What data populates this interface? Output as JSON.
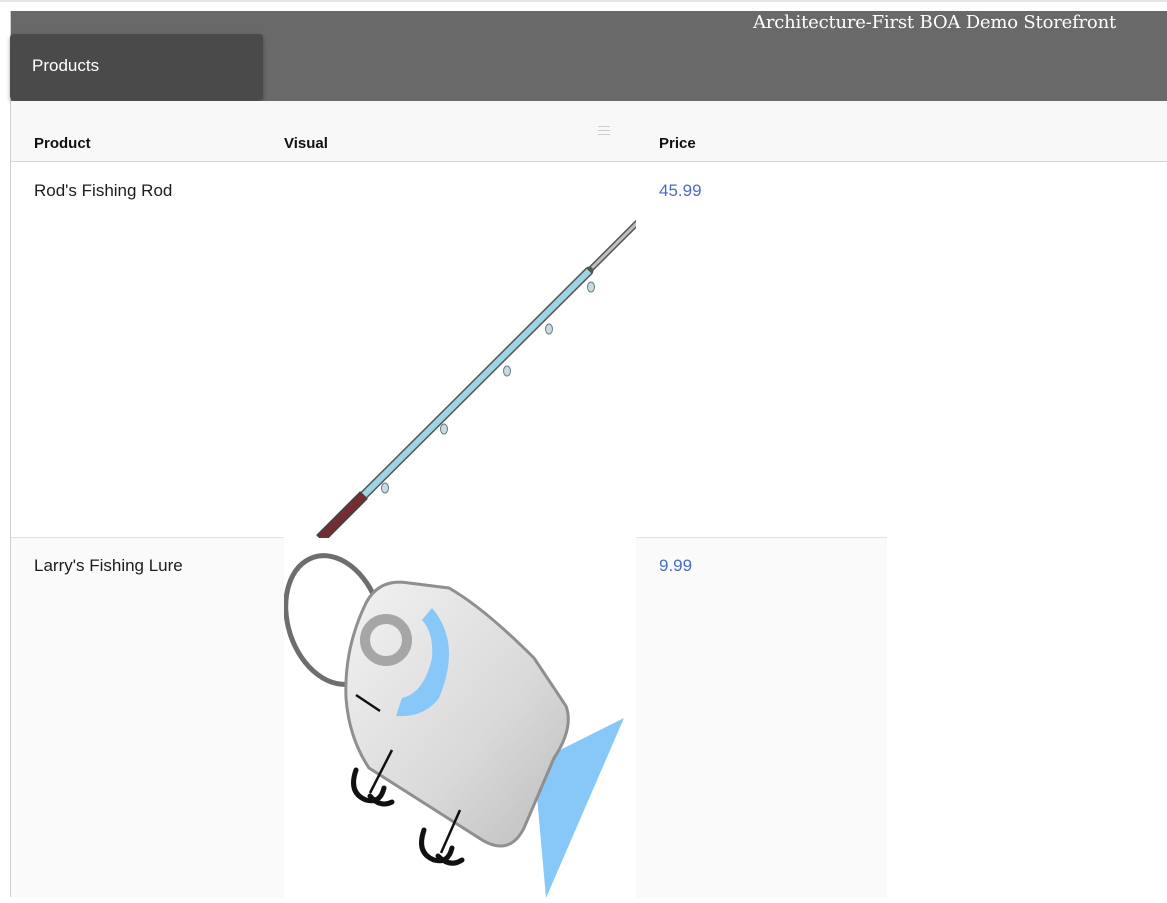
{
  "header": {
    "title": "Architecture-First BOA Demo Storefront",
    "tab_label": "Products"
  },
  "grid": {
    "columns": [
      "Product",
      "Visual",
      "Price"
    ],
    "rows": [
      {
        "product": "Rod's Fishing Rod",
        "visual": "fishing-rod-image",
        "price": "45.99"
      },
      {
        "product": "Larry's Fishing Lure",
        "visual": "fishing-lure-image",
        "price": "9.99"
      }
    ]
  },
  "colors": {
    "header_bg": "#696969",
    "tab_bg": "#4a4a4a",
    "price_link": "#4a6cc4",
    "rod_blank": "#9fd4e3",
    "rod_handle": "#9b1b25",
    "lure_fin": "#87c8f8"
  }
}
